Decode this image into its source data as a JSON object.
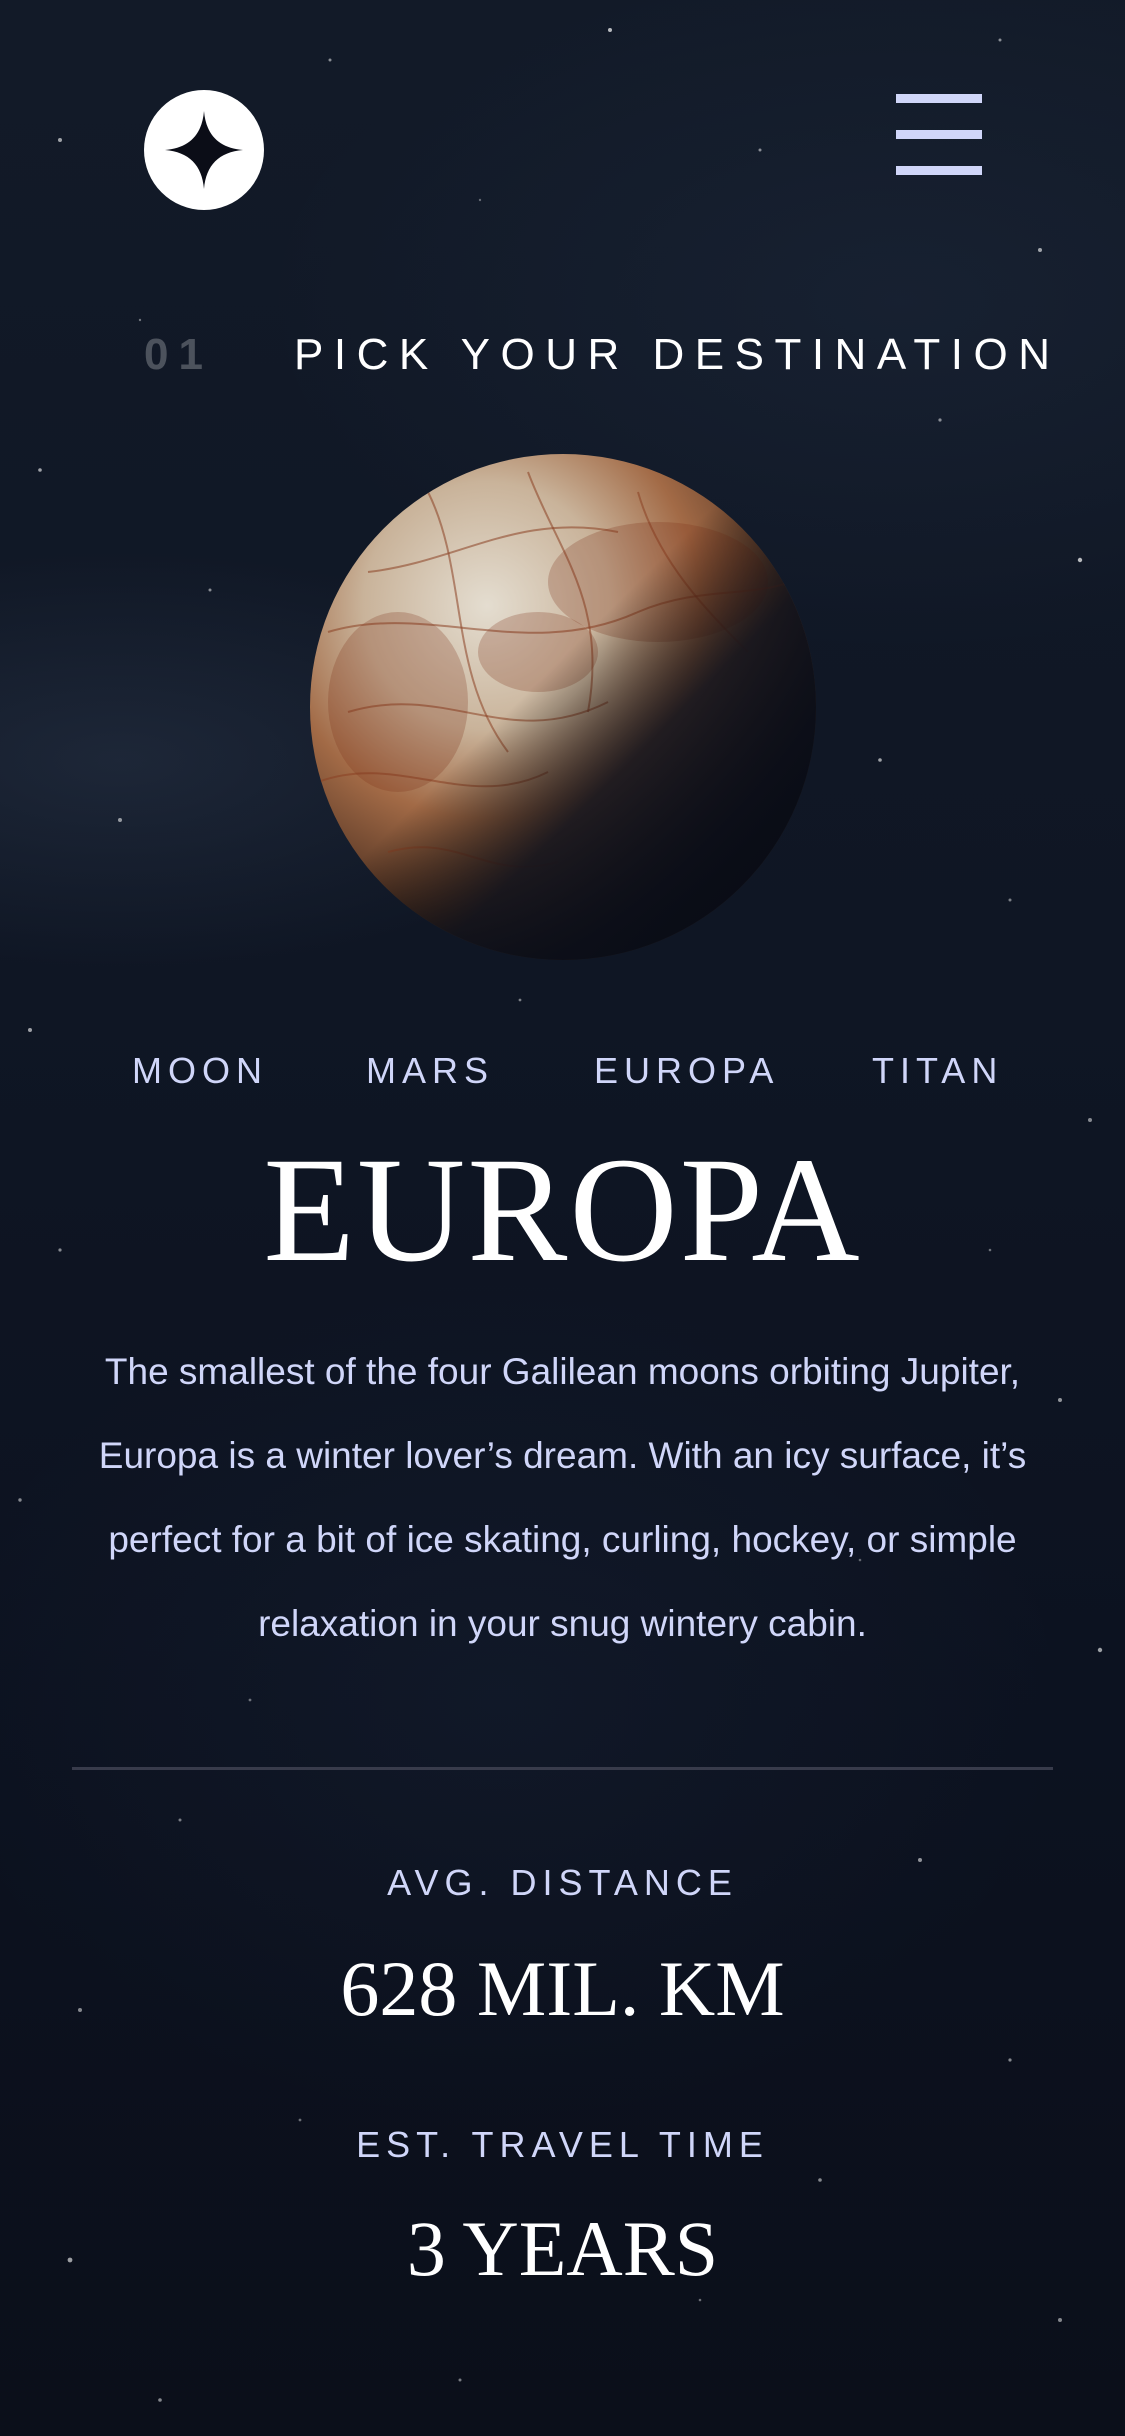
{
  "header": {
    "logo_icon": "star-logo-icon",
    "menu_icon": "hamburger-menu-icon"
  },
  "page": {
    "number": "01",
    "title": "PICK YOUR DESTINATION"
  },
  "tabs": [
    {
      "label": "MOON"
    },
    {
      "label": "MARS"
    },
    {
      "label": "EUROPA"
    },
    {
      "label": "TITAN"
    }
  ],
  "destination": {
    "name": "EUROPA",
    "description": "The smallest of the four Galilean moons orbiting Jupiter, Europa is a winter lover’s dream. With an icy surface, it’s perfect for a bit of ice skating, curling, hockey, or simple relaxation in your snug wintery cabin.",
    "distance_label": "AVG. DISTANCE",
    "distance_value": "628 MIL. KM",
    "travel_label": "EST. TRAVEL TIME",
    "travel_value": "3 YEARS"
  },
  "colors": {
    "background": "#0b0d17",
    "accent_lavender": "#d0d6f9",
    "white": "#ffffff"
  }
}
